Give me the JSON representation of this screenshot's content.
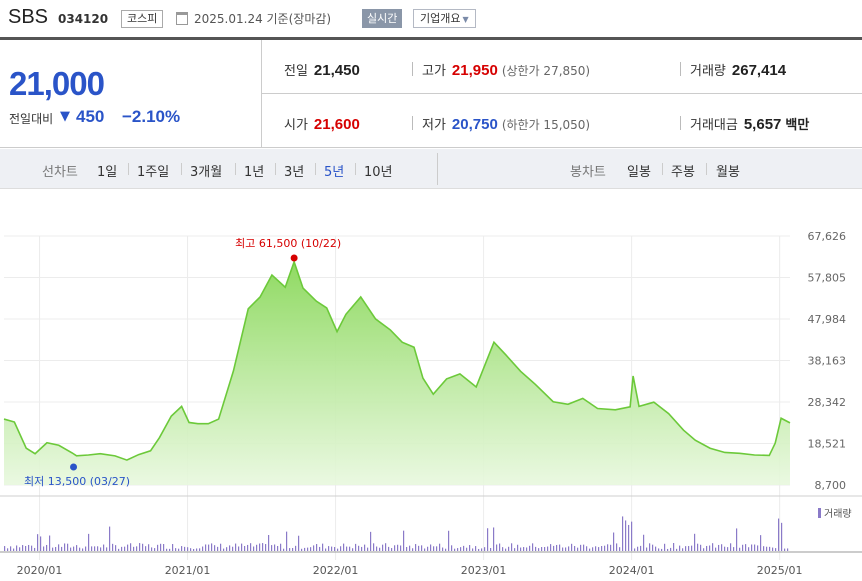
{
  "header": {
    "name": "SBS",
    "code": "034120",
    "market": "코스피",
    "date_basis": "2025.01.24 기준(장마감)",
    "realtime_label": "실시간",
    "company_label": "기업개요"
  },
  "quote": {
    "price": "21,000",
    "change_label": "전일대비",
    "change_amount": "450",
    "change_rate": "−2.10%",
    "prev_close": {
      "label": "전일",
      "value": "21,450"
    },
    "high": {
      "label": "고가",
      "value": "21,950",
      "limit_label": "(상한가 27,850)"
    },
    "volume": {
      "label": "거래량",
      "value": "267,414"
    },
    "open": {
      "label": "시가",
      "value": "21,600"
    },
    "low": {
      "label": "저가",
      "value": "20,750",
      "limit_label": "(하한가 15,050)"
    },
    "trade_value": {
      "label": "거래대금",
      "value": "5,657",
      "unit": "백만"
    }
  },
  "period_bar": {
    "line_label": "선차트",
    "line_items": [
      "1일",
      "1주일",
      "3개월",
      "1년",
      "3년",
      "5년",
      "10년"
    ],
    "selected": "5년",
    "candle_label": "봉차트",
    "candle_items": [
      "일봉",
      "주봉",
      "월봉"
    ]
  },
  "colors": {
    "accent_blue": "#2a54c8",
    "up_red": "#d60000",
    "line_green": "#6cc93a",
    "volume_purple": "#8a7ac8"
  },
  "chart_data": {
    "type": "area",
    "y_ticks": [
      "67,626",
      "57,805",
      "47,984",
      "38,163",
      "28,342",
      "18,521",
      "8,700"
    ],
    "ylim": [
      8700,
      67626
    ],
    "x_ticks": [
      "2020/01",
      "2021/01",
      "2022/01",
      "2023/01",
      "2024/01",
      "2025/01"
    ],
    "max_label": "최고 61,500 (10/22)",
    "min_label": "최저 13,500 (03/27)",
    "volume_legend": "거래량",
    "grid": true,
    "series": [
      {
        "values": [
          [
            2019.75,
            24300
          ],
          [
            2019.82,
            23600
          ],
          [
            2019.9,
            17400
          ],
          [
            2019.96,
            16100
          ],
          [
            2020.04,
            18700
          ],
          [
            2020.12,
            18100
          ],
          [
            2020.21,
            16300
          ],
          [
            2020.24,
            15600
          ],
          [
            2020.32,
            15800
          ],
          [
            2020.4,
            16100
          ],
          [
            2020.5,
            15600
          ],
          [
            2020.58,
            14600
          ],
          [
            2020.66,
            15900
          ],
          [
            2020.74,
            16800
          ],
          [
            2020.8,
            19900
          ],
          [
            2020.88,
            25000
          ],
          [
            2020.95,
            27300
          ],
          [
            2021.0,
            23500
          ],
          [
            2021.06,
            23200
          ],
          [
            2021.13,
            23200
          ],
          [
            2021.2,
            24300
          ],
          [
            2021.3,
            35700
          ],
          [
            2021.4,
            50400
          ],
          [
            2021.48,
            53200
          ],
          [
            2021.56,
            58400
          ],
          [
            2021.65,
            55500
          ],
          [
            2021.71,
            61500
          ],
          [
            2021.77,
            55300
          ],
          [
            2021.86,
            52200
          ],
          [
            2021.93,
            50600
          ],
          [
            2022.0,
            45000
          ],
          [
            2022.06,
            49100
          ],
          [
            2022.16,
            53200
          ],
          [
            2022.26,
            48000
          ],
          [
            2022.36,
            45400
          ],
          [
            2022.44,
            42500
          ],
          [
            2022.52,
            41300
          ],
          [
            2022.58,
            34000
          ],
          [
            2022.65,
            30200
          ],
          [
            2022.74,
            33800
          ],
          [
            2022.83,
            35000
          ],
          [
            2022.94,
            31900
          ],
          [
            2023.06,
            42500
          ],
          [
            2023.14,
            39500
          ],
          [
            2023.24,
            35600
          ],
          [
            2023.34,
            32500
          ],
          [
            2023.46,
            28400
          ],
          [
            2023.56,
            27800
          ],
          [
            2023.66,
            29200
          ],
          [
            2023.76,
            26800
          ],
          [
            2023.88,
            26500
          ],
          [
            2023.98,
            27200
          ],
          [
            2024.0,
            34500
          ],
          [
            2024.04,
            27300
          ],
          [
            2024.14,
            28300
          ],
          [
            2024.24,
            25600
          ],
          [
            2024.34,
            21700
          ],
          [
            2024.42,
            19300
          ],
          [
            2024.52,
            17400
          ],
          [
            2024.62,
            16400
          ],
          [
            2024.72,
            16200
          ],
          [
            2024.82,
            15800
          ],
          [
            2024.92,
            15700
          ],
          [
            2024.96,
            18600
          ],
          [
            2025.0,
            24500
          ],
          [
            2025.06,
            23400
          ]
        ]
      }
    ]
  }
}
